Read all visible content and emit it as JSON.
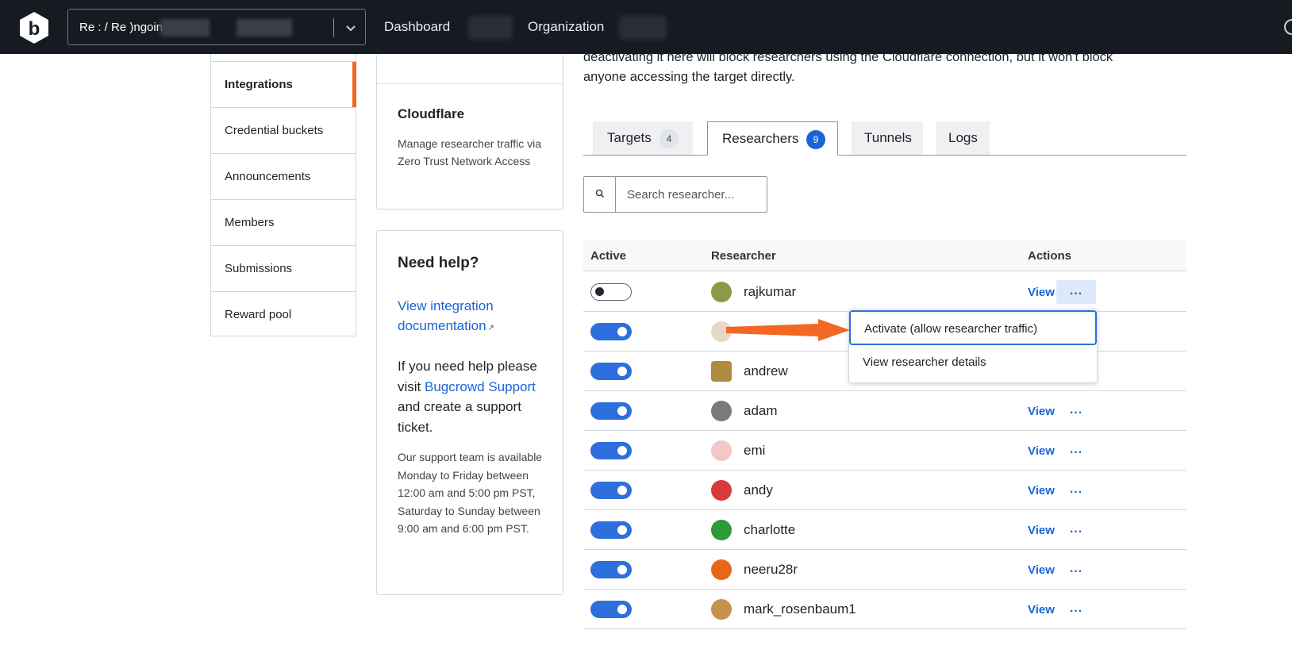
{
  "topbar": {
    "program_label": "Re           : / Re                )ngoing",
    "nav": [
      {
        "label": "Dashboard"
      },
      {
        "label": "Organization"
      }
    ]
  },
  "sidebar": {
    "items": [
      {
        "label": "Integrations",
        "active": true
      },
      {
        "label": "Credential buckets"
      },
      {
        "label": "Announcements"
      },
      {
        "label": "Members"
      },
      {
        "label": "Submissions"
      },
      {
        "label": "Reward pool"
      }
    ]
  },
  "cloudflare_card": {
    "title": "Cloudflare",
    "description": "Manage researcher traffic via Zero Trust Network Access"
  },
  "help_card": {
    "title": "Need help?",
    "doc_link": "View integration documentation",
    "text_before": "If you need help please visit ",
    "support_link": "Bugcrowd Support",
    "text_after": " and create a support ticket.",
    "hours": "Our support team is available Monday to Friday between 12:00 am and 5:00 pm PST, Saturday to Sunday between 9:00 am and 6:00 pm PST."
  },
  "main": {
    "intro": "deactivating it here will block researchers using the Cloudflare connection, but it won't block anyone accessing the target directly.",
    "tabs": [
      {
        "label": "Targets",
        "count": "4"
      },
      {
        "label": "Researchers",
        "count": "9"
      },
      {
        "label": "Tunnels"
      },
      {
        "label": "Logs"
      }
    ],
    "search": {
      "placeholder": "Search researcher..."
    },
    "table": {
      "headers": {
        "active": "Active",
        "researcher": "Researcher",
        "actions": "Actions"
      },
      "view_label": "View",
      "more_label": "...",
      "rows": [
        {
          "name": "rajkumar",
          "active": false,
          "avatar_color": "#8a9a4a"
        },
        {
          "name": "",
          "active": true,
          "avatar_color": "#e8d8c8"
        },
        {
          "name": "andrew",
          "active": true,
          "avatar_color": "#b08a40"
        },
        {
          "name": "adam",
          "active": true,
          "avatar_color": "#7a7a7a"
        },
        {
          "name": "emi",
          "active": true,
          "avatar_color": "#f4c6c6"
        },
        {
          "name": "andy",
          "active": true,
          "avatar_color": "#d63a3a"
        },
        {
          "name": "charlotte",
          "active": true,
          "avatar_color": "#2a9a3a"
        },
        {
          "name": "neeru28r",
          "active": true,
          "avatar_color": "#e8661a"
        },
        {
          "name": "mark_rosenbaum1",
          "active": true,
          "avatar_color": "#c8924a"
        }
      ]
    },
    "menu": {
      "items": [
        {
          "label": "Activate (allow researcher traffic)"
        },
        {
          "label": "View researcher details"
        }
      ]
    }
  },
  "colors": {
    "accent": "#1a64d6",
    "annotation_arrow": "#f26822",
    "topbar": "#161b22"
  }
}
